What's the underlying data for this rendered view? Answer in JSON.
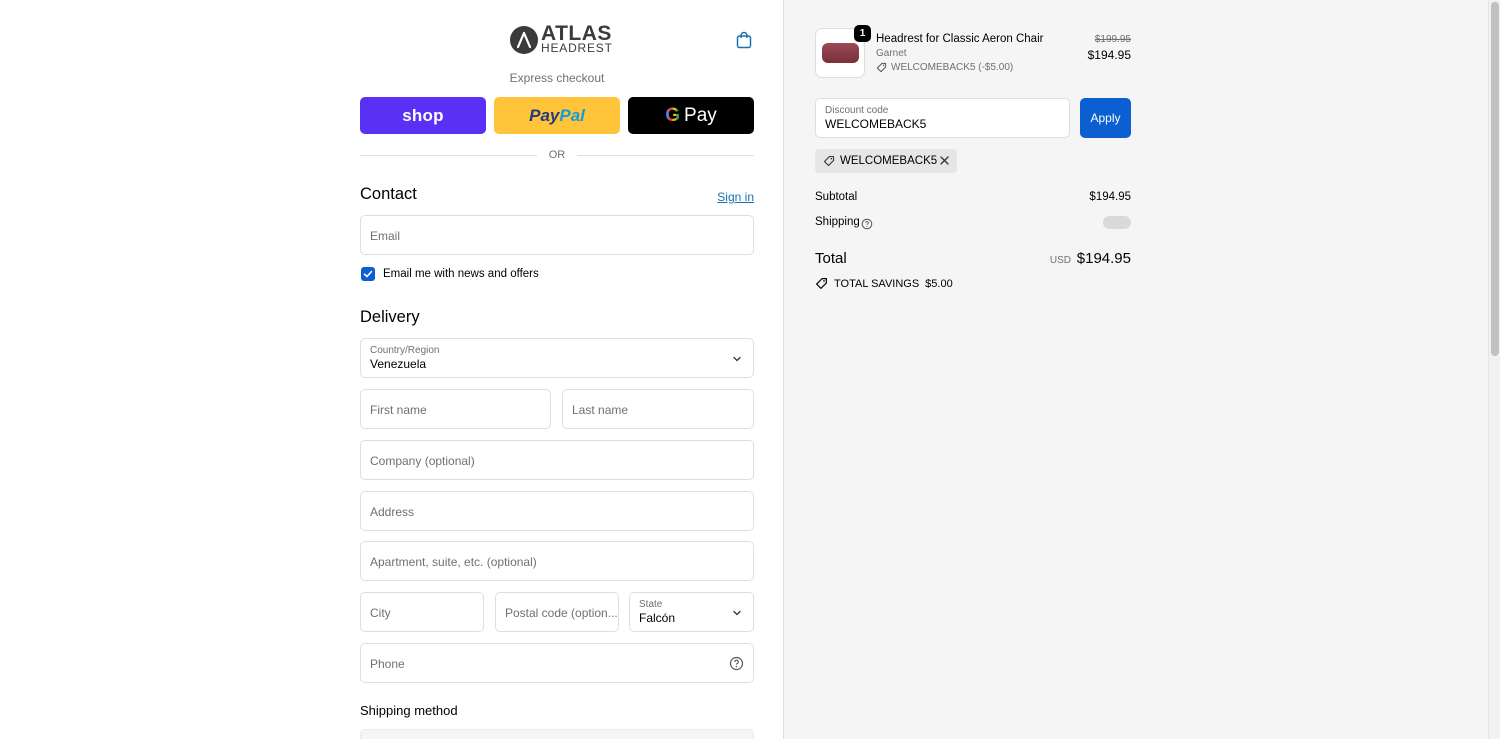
{
  "brand": {
    "name": "ATLAS",
    "sub": "HEADREST"
  },
  "express": {
    "label": "Express checkout",
    "shop_label": "shop",
    "paypal_part1": "Pay",
    "paypal_part2": "Pal",
    "gpay_g": "G",
    "gpay_label": "Pay"
  },
  "or_label": "OR",
  "contact": {
    "title": "Contact",
    "signin": "Sign in",
    "email_placeholder": "Email",
    "newsletter_label": "Email me with news and offers",
    "newsletter_checked": true
  },
  "delivery": {
    "title": "Delivery",
    "country_label": "Country/Region",
    "country_value": "Venezuela",
    "first_name": "First name",
    "last_name": "Last name",
    "company": "Company (optional)",
    "address": "Address",
    "apartment": "Apartment, suite, etc. (optional)",
    "city": "City",
    "postal": "Postal code (option...",
    "state_label": "State",
    "state_value": "Falcón",
    "phone": "Phone"
  },
  "shipping_method_title": "Shipping method",
  "order": {
    "item": {
      "quantity": "1",
      "name": "Headrest for Classic Aeron Chair",
      "variant": "Garnet",
      "discount": "WELCOMEBACK5 (-$5.00)",
      "price_original": "$199.95",
      "price": "$194.95"
    },
    "discount_code_label": "Discount code",
    "discount_code_value": "WELCOMEBACK5",
    "apply_label": "Apply",
    "applied_code": "WELCOMEBACK5",
    "subtotal_label": "Subtotal",
    "subtotal_value": "$194.95",
    "shipping_label": "Shipping",
    "total_label": "Total",
    "total_currency": "USD",
    "total_value": "$194.95",
    "savings_label": "TOTAL SAVINGS",
    "savings_value": "$5.00"
  },
  "colors": {
    "accent": "#0b5fd0",
    "link": "#1773b0",
    "shop": "#5a31f4",
    "paypal": "#ffc439"
  }
}
